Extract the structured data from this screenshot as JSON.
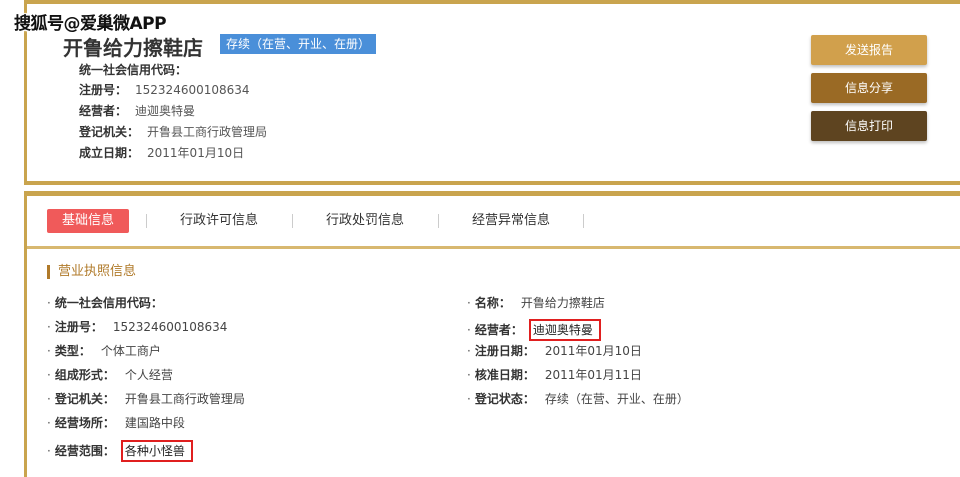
{
  "watermark": "搜狐号@爱巢微APP",
  "header": {
    "company_name": "开鲁给力擦鞋店",
    "status": "存续（在营、开业、在册）",
    "credit_code_label": "统一社会信用代码：",
    "credit_code_value": "",
    "reg_no_label": "注册号：",
    "reg_no_value": "152324600108634",
    "operator_label": "经营者：",
    "operator_value": "迪迦奥特曼",
    "authority_label": "登记机关：",
    "authority_value": "开鲁县工商行政管理局",
    "founded_label": "成立日期：",
    "founded_value": "2011年01月10日"
  },
  "actions": {
    "send_report": "发送报告",
    "share": "信息分享",
    "print": "信息打印"
  },
  "tabs": [
    "基础信息",
    "行政许可信息",
    "行政处罚信息",
    "经营异常信息"
  ],
  "section_title": "营业执照信息",
  "left_fields": [
    {
      "label": "统一社会信用代码：",
      "value": ""
    },
    {
      "label": "注册号：",
      "value": "152324600108634"
    },
    {
      "label": "类型：",
      "value": "个体工商户"
    },
    {
      "label": "组成形式：",
      "value": "个人经营"
    },
    {
      "label": "登记机关：",
      "value": "开鲁县工商行政管理局"
    },
    {
      "label": "经营场所：",
      "value": "建国路中段"
    },
    {
      "label": "经营范围：",
      "value": "各种小怪兽"
    }
  ],
  "right_fields": [
    {
      "label": "名称：",
      "value": "开鲁给力擦鞋店"
    },
    {
      "label": "经营者：",
      "value": "迪迦奥特曼"
    },
    {
      "label": "注册日期：",
      "value": "2011年01月10日"
    },
    {
      "label": "核准日期：",
      "value": "2011年01月11日"
    },
    {
      "label": "登记状态：",
      "value": "存续（在营、开业、在册）"
    }
  ],
  "colors": {
    "gold_border": "#c9a44e",
    "active_tab": "#f05a5a",
    "status_tag": "#4a8fd9",
    "highlight_box": "#e01f1f"
  }
}
